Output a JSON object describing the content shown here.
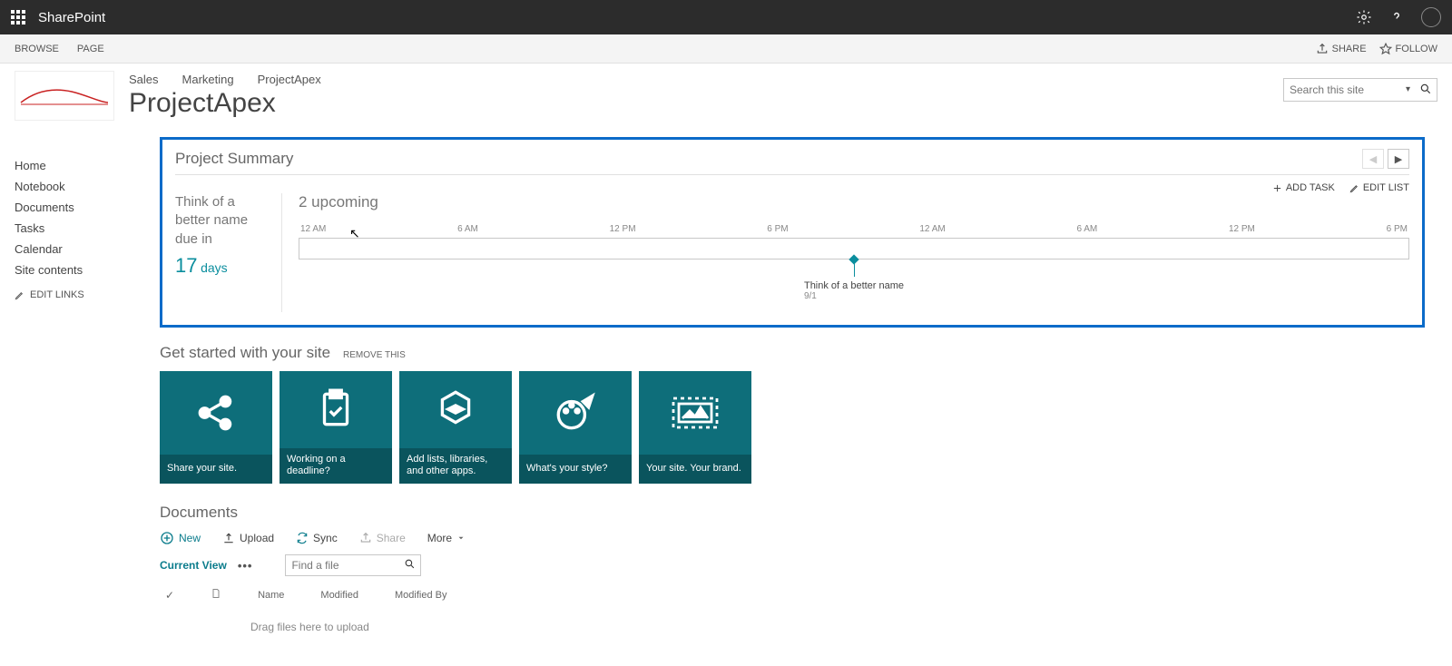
{
  "topbar": {
    "brand": "SharePoint"
  },
  "ribbon": {
    "browse": "BROWSE",
    "page": "PAGE",
    "share": "SHARE",
    "follow": "FOLLOW"
  },
  "nav": {
    "sales": "Sales",
    "marketing": "Marketing",
    "apex": "ProjectApex"
  },
  "page_title": "ProjectApex",
  "search": {
    "placeholder": "Search this site"
  },
  "sidebar": {
    "items": [
      {
        "label": "Home"
      },
      {
        "label": "Notebook"
      },
      {
        "label": "Documents"
      },
      {
        "label": "Tasks"
      },
      {
        "label": "Calendar"
      },
      {
        "label": "Site contents"
      }
    ],
    "edit_links": "EDIT LINKS"
  },
  "project": {
    "title": "Project Summary",
    "add_task": "ADD TASK",
    "edit_list": "EDIT LIST",
    "due_line1": "Think of a",
    "due_line2": "better name",
    "due_line3": "due in",
    "due_num": "17",
    "due_days": "days",
    "upcoming": "2 upcoming",
    "ticks": [
      "12 AM",
      "6 AM",
      "12 PM",
      "6 PM",
      "12 AM",
      "6 AM",
      "12 PM",
      "6 PM"
    ],
    "milestone_label": "Think of a better name",
    "milestone_date": "9/1"
  },
  "get_started": {
    "title": "Get started with your site",
    "remove": "REMOVE THIS",
    "tiles": [
      {
        "label": "Share your site."
      },
      {
        "label": "Working on a deadline?"
      },
      {
        "label": "Add lists, libraries, and other apps."
      },
      {
        "label": "What's your style?"
      },
      {
        "label": "Your site. Your brand."
      }
    ]
  },
  "documents": {
    "title": "Documents",
    "new": "New",
    "upload": "Upload",
    "sync": "Sync",
    "share": "Share",
    "more": "More",
    "current_view": "Current View",
    "find_placeholder": "Find a file",
    "cols": {
      "name": "Name",
      "modified": "Modified",
      "modified_by": "Modified By"
    },
    "drop_msg": "Drag files here to upload"
  }
}
